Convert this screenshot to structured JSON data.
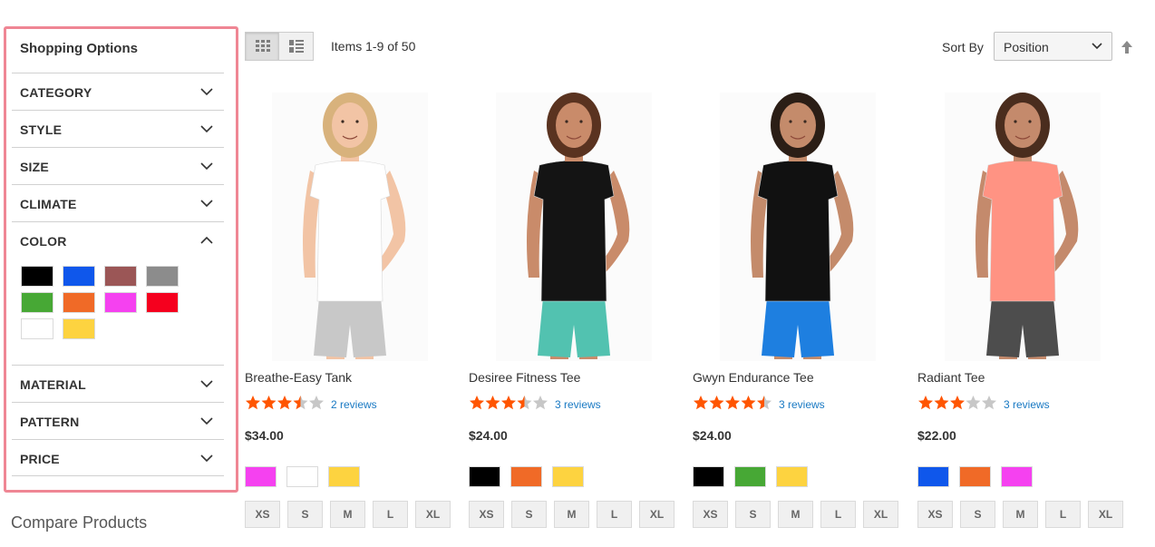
{
  "sidebar": {
    "title": "Shopping Options",
    "filters": [
      {
        "label": "CATEGORY",
        "expanded": false
      },
      {
        "label": "STYLE",
        "expanded": false
      },
      {
        "label": "SIZE",
        "expanded": false
      },
      {
        "label": "CLIMATE",
        "expanded": false
      },
      {
        "label": "COLOR",
        "expanded": true
      },
      {
        "label": "MATERIAL",
        "expanded": false
      },
      {
        "label": "PATTERN",
        "expanded": false
      },
      {
        "label": "PRICE",
        "expanded": false
      }
    ],
    "color_swatches": [
      "#000000",
      "#0f57eb",
      "#9b5656",
      "#8c8c8c",
      "#47a835",
      "#f06a27",
      "#f541f0",
      "#f5001e",
      "#ffffff",
      "#fdd340"
    ],
    "compare_title": "Compare Products",
    "accent_color": "#ef8694"
  },
  "toolbar": {
    "view_modes": [
      "grid",
      "list"
    ],
    "active_view": "grid",
    "items_count": "Items 1-9 of 50",
    "sort_label": "Sort By",
    "sort_value": "Position",
    "sort_direction_icon": "arrow-up-icon"
  },
  "products": [
    {
      "name": "Breathe-Easy Tank",
      "rating": 3.5,
      "reviews": "2 reviews",
      "price": "$34.00",
      "swatches": [
        "#f541f0",
        "#ffffff",
        "#fdd340"
      ],
      "sizes": [
        "XS",
        "S",
        "M",
        "L",
        "XL"
      ],
      "figure": {
        "top": "#ffffff",
        "bottom": "#c8c8c8",
        "skin": "#f2c4a5",
        "hair": "#d8b27c"
      }
    },
    {
      "name": "Desiree Fitness Tee",
      "rating": 3.5,
      "reviews": "3 reviews",
      "price": "$24.00",
      "swatches": [
        "#000000",
        "#f06a27",
        "#fdd340"
      ],
      "sizes": [
        "XS",
        "S",
        "M",
        "L",
        "XL"
      ],
      "figure": {
        "top": "#141414",
        "bottom": "#52c2b0",
        "skin": "#c98b6a",
        "hair": "#5a3320"
      }
    },
    {
      "name": "Gwyn Endurance Tee",
      "rating": 4.5,
      "reviews": "3 reviews",
      "price": "$24.00",
      "swatches": [
        "#000000",
        "#47a835",
        "#fdd340"
      ],
      "sizes": [
        "XS",
        "S",
        "M",
        "L",
        "XL"
      ],
      "figure": {
        "top": "#111111",
        "bottom": "#1e7fe0",
        "skin": "#c48b6b",
        "hair": "#2b1e16"
      }
    },
    {
      "name": "Radiant Tee",
      "rating": 3,
      "reviews": "3 reviews",
      "price": "$22.00",
      "swatches": [
        "#0f57eb",
        "#f06a27",
        "#f541f0"
      ],
      "sizes": [
        "XS",
        "S",
        "M",
        "L",
        "XL"
      ],
      "figure": {
        "top": "#ff9383",
        "bottom": "#4d4d4d",
        "skin": "#c48a6c",
        "hair": "#4a2d1e"
      }
    }
  ],
  "colors": {
    "star": "#ff5501",
    "star_empty": "#c7c7c7",
    "link": "#1979c3"
  }
}
